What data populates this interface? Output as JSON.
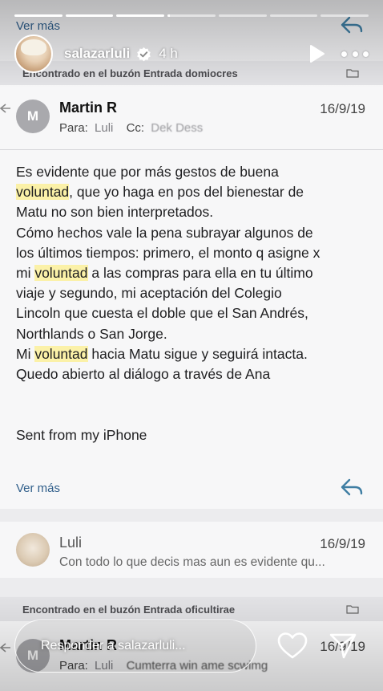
{
  "story": {
    "username": "salazarluli",
    "time": "4 h",
    "progress": [
      1,
      1,
      1,
      0.05,
      0,
      0,
      0
    ],
    "reply_placeholder": "Responder a salazarluli..."
  },
  "mailbox_top": {
    "text": "Encontrado en el buzón Entrada domiocres"
  },
  "top_partial": {
    "ver_mas": "Ver más"
  },
  "email1": {
    "avatar_letter": "M",
    "sender": "Martin R",
    "date": "16/9/19",
    "to_label": "Para:",
    "to_name": "Luli",
    "cc_label": "Cc:",
    "cc_name": "Dek Dess",
    "body": [
      "Es evidente que por más gestos de buena",
      "voluntad, que yo haga en pos del bienestar de",
      "Matu no son bien interpretados.",
      "Cómo hechos vale la pena subrayar algunos de",
      "los últimos tiempos: primero, el monto q asigne x",
      "mi voluntad a las compras para ella en tu último",
      "viaje y segundo, mi aceptación del Colegio",
      "Lincoln que cuesta el doble que el San Andrés,",
      "Northlands o San Jorge.",
      "Mi voluntad hacia Matu sigue y seguirá intacta.",
      "Quedo abierto al diálogo a través de Ana"
    ],
    "signature": "Sent from my iPhone",
    "ver_mas": "Ver más"
  },
  "email2": {
    "sender": "Luli",
    "date": "16/9/19",
    "preview": "Con todo lo que decis mas aun es evidente qu..."
  },
  "mailbox_bottom": {
    "text": "Encontrado en el buzón Entrada oficultirae"
  },
  "email3": {
    "avatar_letter": "M",
    "sender": "Martin R",
    "date": "16/9/19",
    "to_label": "Para:",
    "to_name": "Luli",
    "cc_text": "Cumterra win ame scwimg"
  },
  "colors": {
    "highlight": "#fbf1a8",
    "link": "#2f5e8a",
    "avatar_gray": "#a9a9ad"
  }
}
